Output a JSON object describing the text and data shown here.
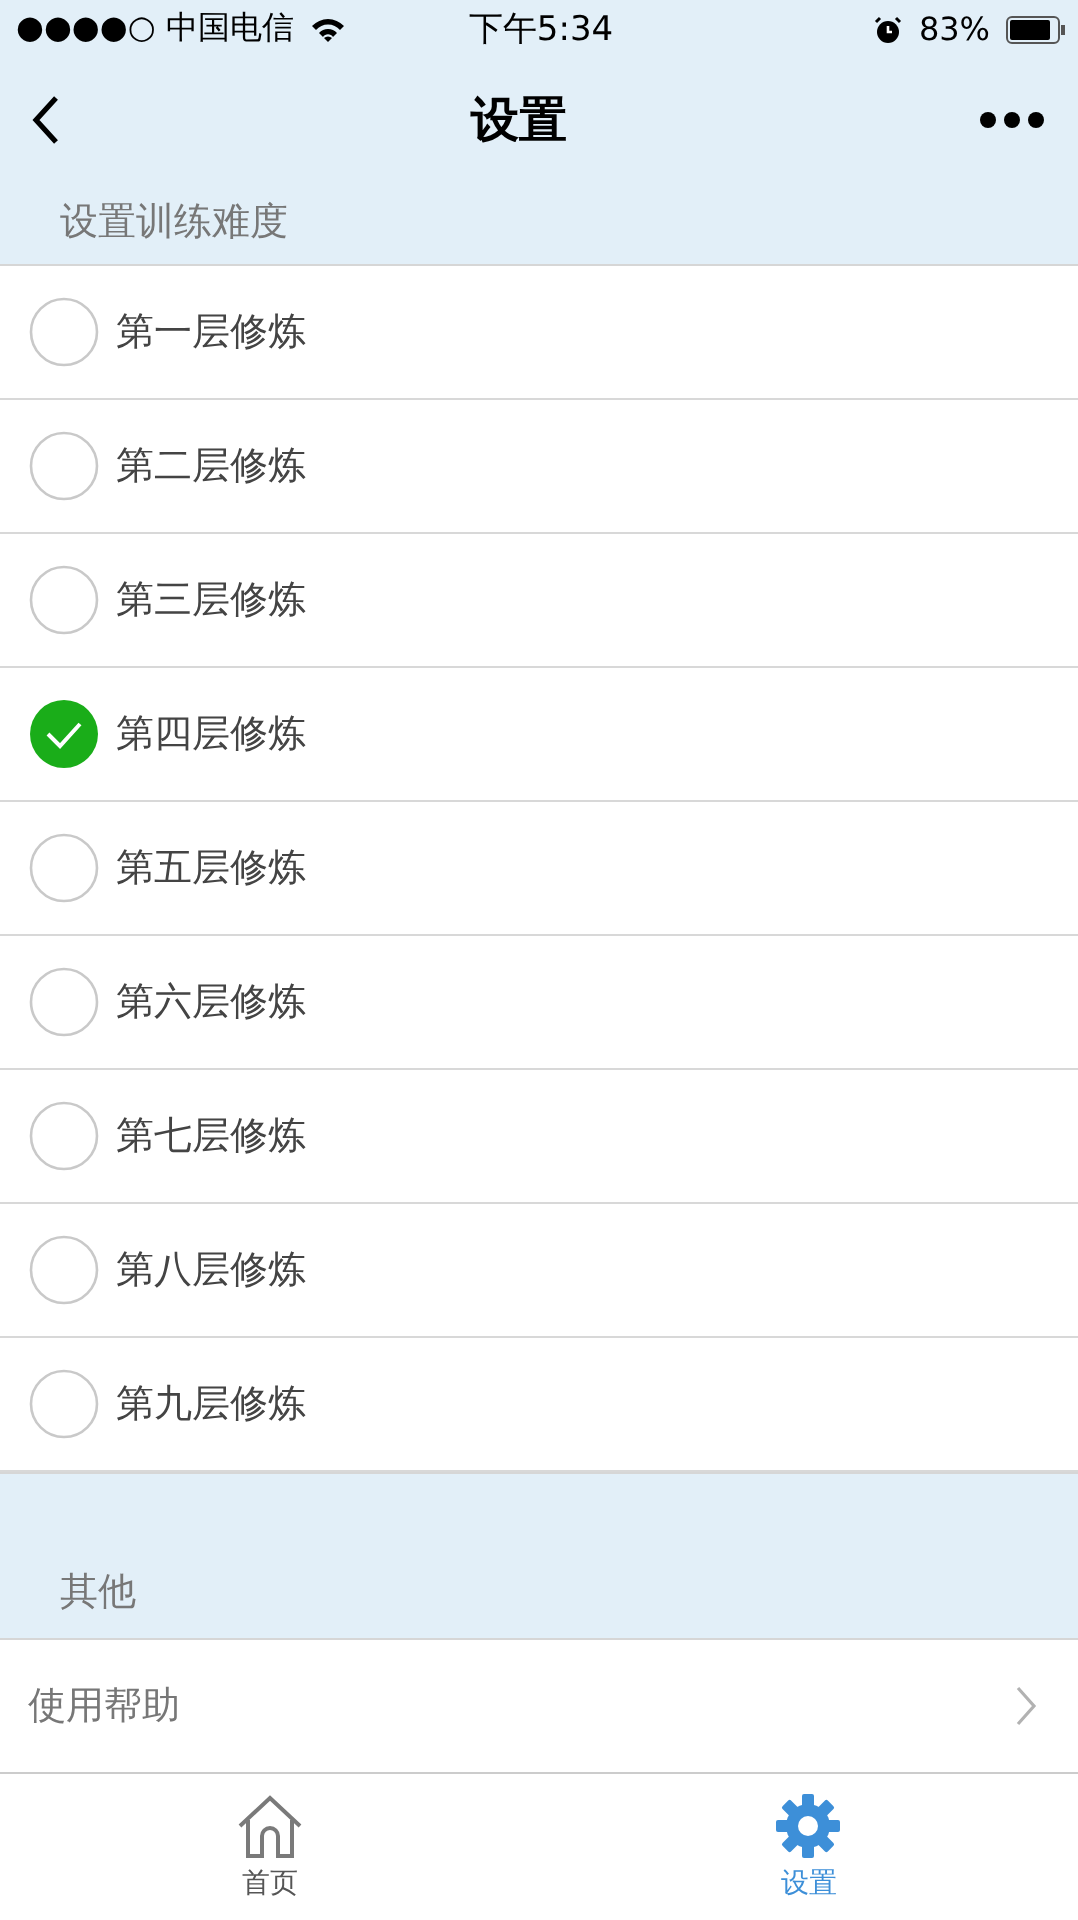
{
  "status_bar": {
    "carrier": "●●●●○ 中国电信",
    "time": "下午5:34",
    "battery": "83%"
  },
  "nav": {
    "title": "设置"
  },
  "sections": [
    {
      "header": "设置训练难度",
      "kind": "radio",
      "items": [
        {
          "label": "第一层修炼",
          "selected": false
        },
        {
          "label": "第二层修炼",
          "selected": false
        },
        {
          "label": "第三层修炼",
          "selected": false
        },
        {
          "label": "第四层修炼",
          "selected": true
        },
        {
          "label": "第五层修炼",
          "selected": false
        },
        {
          "label": "第六层修炼",
          "selected": false
        },
        {
          "label": "第七层修炼",
          "selected": false
        },
        {
          "label": "第八层修炼",
          "selected": false
        },
        {
          "label": "第九层修炼",
          "selected": false
        }
      ]
    },
    {
      "header": "其他",
      "kind": "link",
      "items": [
        {
          "label": "使用帮助"
        }
      ]
    }
  ],
  "tab_bar": [
    {
      "label": "首页",
      "kind": "home",
      "selected": false
    },
    {
      "label": "设置",
      "kind": "settings",
      "selected": true
    }
  ]
}
